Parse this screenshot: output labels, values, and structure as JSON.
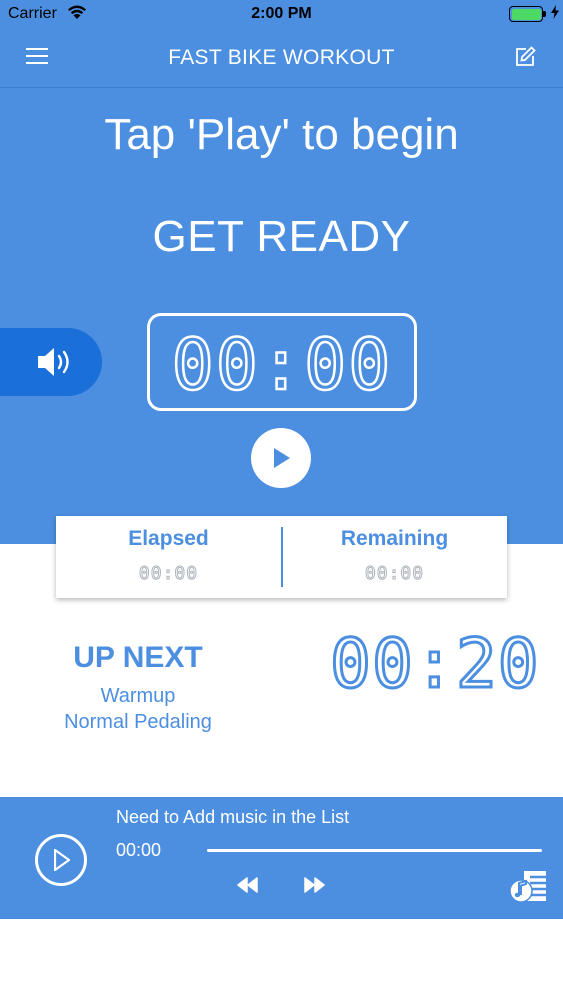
{
  "status": {
    "carrier": "Carrier",
    "time": "2:00 PM",
    "battery_icon": "battery-full-icon",
    "charging_icon": "charging-bolt-icon"
  },
  "nav": {
    "title": "FAST BIKE WORKOUT",
    "menu_icon": "hamburger-menu-icon",
    "edit_icon": "edit-icon"
  },
  "hero": {
    "prompt": "Tap 'Play' to begin",
    "phase": "GET READY",
    "timer": "00:00",
    "sound_icon": "speaker-icon",
    "play_icon": "play-icon"
  },
  "stats": {
    "elapsed_label": "Elapsed",
    "elapsed_value": "00:00",
    "remaining_label": "Remaining",
    "remaining_value": "00:00"
  },
  "up_next": {
    "label": "UP NEXT",
    "name": "Warmup",
    "description": "Normal Pedaling",
    "time": "00:20"
  },
  "player": {
    "track_title": "Need to Add music in the List",
    "current_time": "00:00",
    "progress": 0,
    "play_icon": "play-icon",
    "rewind_icon": "rewind-icon",
    "forward_icon": "fast-forward-icon",
    "playlist_icon": "music-playlist-icon"
  },
  "colors": {
    "accent": "#4c8fe0",
    "sound_button": "#1b6fd8",
    "battery": "#4cd964"
  }
}
